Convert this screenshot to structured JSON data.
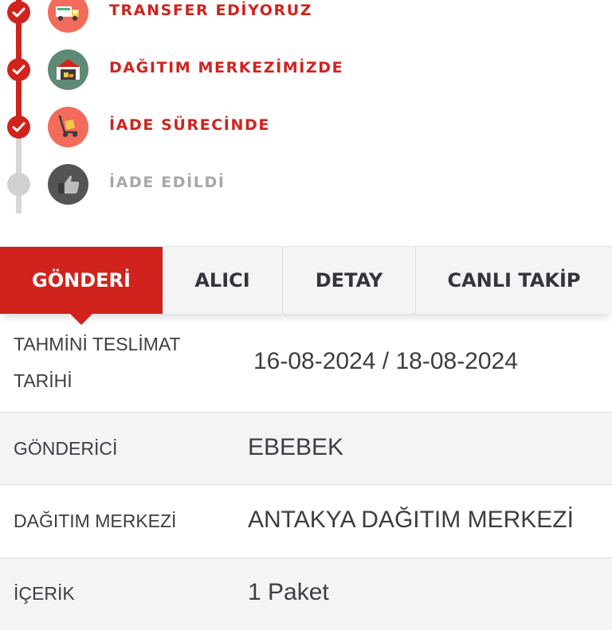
{
  "timeline": {
    "steps": [
      {
        "label": "TRANSFER EDİYORUZ",
        "status": "done",
        "icon": "delivery-truck-icon",
        "icon_bg": "#f26b5b"
      },
      {
        "label": "DAĞITIM MERKEZİMİZDE",
        "status": "done",
        "icon": "warehouse-icon",
        "icon_bg": "#5e8a76"
      },
      {
        "label": "İADE SÜRECİNDE",
        "status": "done",
        "icon": "hand-truck-icon",
        "icon_bg": "#f26b5b"
      },
      {
        "label": "İADE EDİLDİ",
        "status": "pending",
        "icon": "thumbs-up-icon",
        "icon_bg": "#545454"
      }
    ]
  },
  "tabs": [
    {
      "label": "GÖNDERİ",
      "active": true
    },
    {
      "label": "ALICI",
      "active": false
    },
    {
      "label": "DETAY",
      "active": false
    },
    {
      "label": "CANLI TAKİP",
      "active": false
    }
  ],
  "shipment": {
    "rows": [
      {
        "label": "TAHMİNİ TESLİMAT TARİHİ",
        "value": "16-08-2024 / 18-08-2024"
      },
      {
        "label": "GÖNDERİCİ",
        "value": "EBEBEK"
      },
      {
        "label": "DAĞITIM MERKEZİ",
        "value": "ANTAKYA DAĞITIM MERKEZİ"
      },
      {
        "label": "İÇERİK",
        "value": "1 Paket"
      }
    ]
  },
  "colors": {
    "accent": "#d0231d",
    "pending": "#a8a8a8",
    "tab_bg": "#f4f4f5",
    "text": "#3c3e44"
  }
}
